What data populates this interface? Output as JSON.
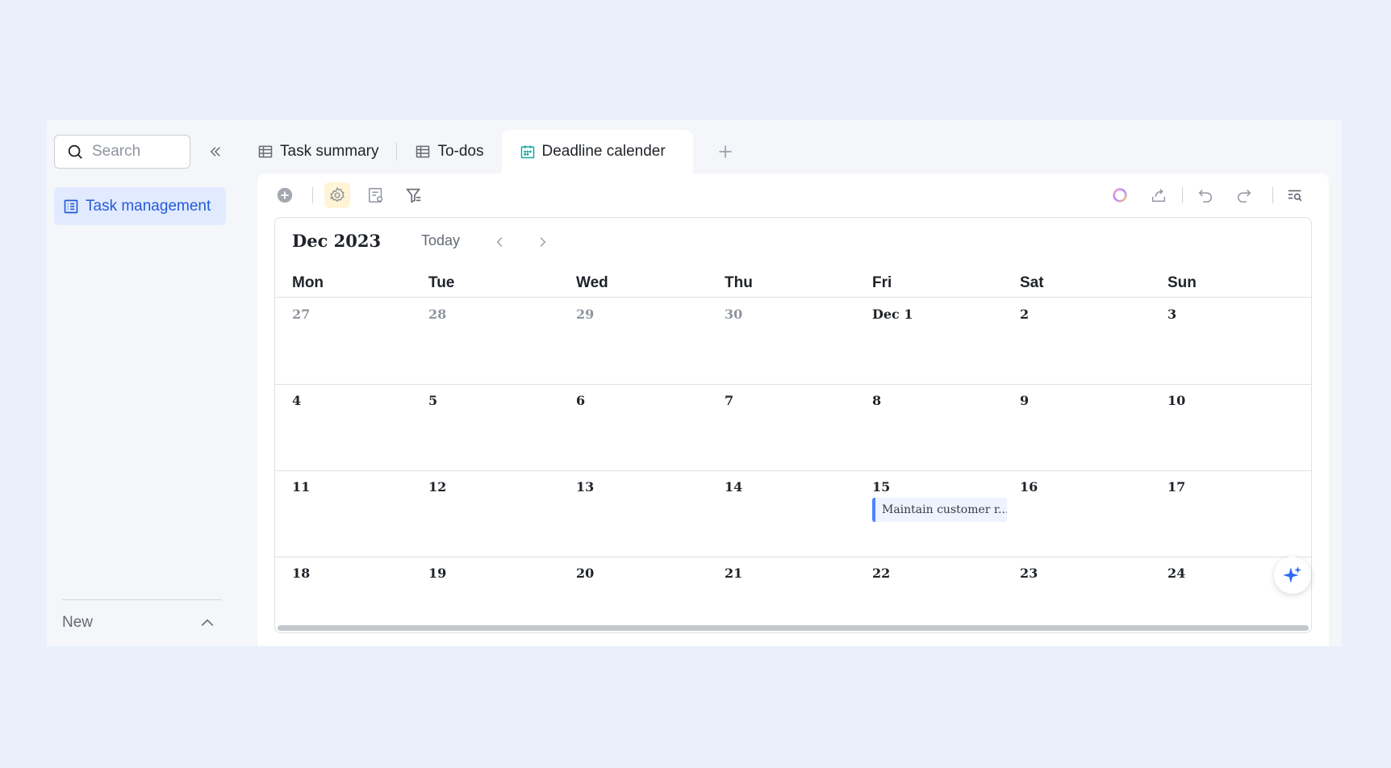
{
  "sidebar": {
    "search_placeholder": "Search",
    "items": [
      {
        "label": "Task management",
        "icon": "table-list-icon"
      }
    ],
    "new_label": "New"
  },
  "tabs": [
    {
      "label": "Task summary",
      "icon": "grid-table-icon"
    },
    {
      "label": "To-dos",
      "icon": "grid-table-icon"
    },
    {
      "label": "Deadline calender",
      "icon": "calendar-icon",
      "active": true
    }
  ],
  "calendar": {
    "month_label": "Dec 2023",
    "today_label": "Today",
    "weekdays": [
      "Mon",
      "Tue",
      "Wed",
      "Thu",
      "Fri",
      "Sat",
      "Sun"
    ],
    "weeks": [
      [
        "27",
        "28",
        "29",
        "30",
        "Dec 1",
        "2",
        "3"
      ],
      [
        "4",
        "5",
        "6",
        "7",
        "8",
        "9",
        "10"
      ],
      [
        "11",
        "12",
        "13",
        "14",
        "15",
        "16",
        "17"
      ],
      [
        "18",
        "19",
        "20",
        "21",
        "22",
        "23",
        "24"
      ]
    ],
    "muted_days": [
      "27",
      "28",
      "29",
      "30"
    ],
    "events": [
      {
        "day": "15",
        "title": "Maintain customer r..."
      }
    ]
  },
  "colors": {
    "accent": "#245bdb",
    "event_bar": "#4e83fd",
    "calendar_tab_icon": "#14a6a0",
    "settings_highlight": "#fff4d6",
    "ai_fab_icon": "#2f6bf6"
  }
}
